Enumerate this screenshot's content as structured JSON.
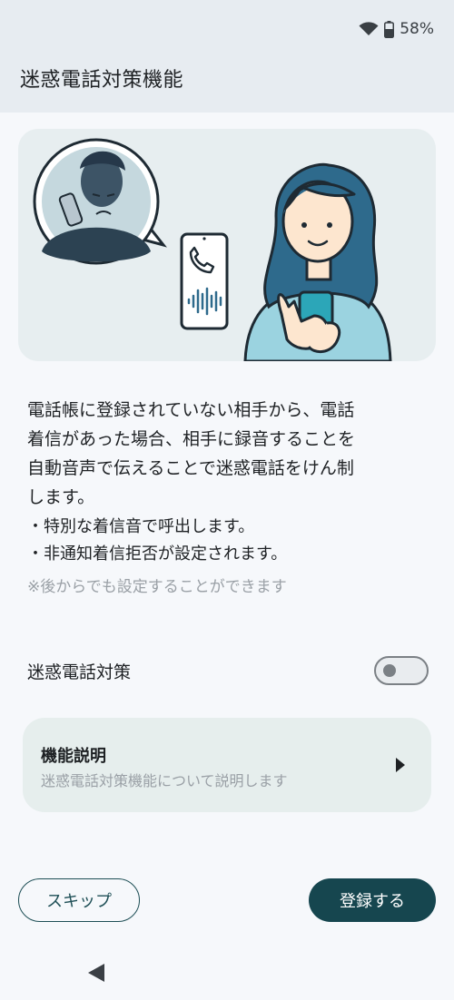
{
  "status_bar": {
    "battery_percent": "58%",
    "icons": [
      "wifi-icon",
      "battery-icon"
    ]
  },
  "header": {
    "title": "迷惑電話対策機能"
  },
  "hero": {
    "illustration": "woman-phone-illustration",
    "colors": {
      "accent": "#1d4e55",
      "skin": "#fde6cf",
      "hair": "#2e6a8c"
    }
  },
  "description": "電話帳に登録されていない相手から、電話\n着信があった場合、相手に録音することを\n自動音声で伝えることで迷惑電話をけん制\nします。",
  "bullets": [
    "・特別な着信音で呼出します。",
    "・非通知着信拒否が設定されます。"
  ],
  "note": "※後からでも設定することができます",
  "toggle": {
    "label": "迷惑電話対策",
    "on": false
  },
  "feature_card": {
    "title": "機能説明",
    "subtitle": "迷惑電話対策機能について説明します"
  },
  "buttons": {
    "skip": "スキップ",
    "register": "登録する"
  },
  "colors": {
    "primary": "#16464f",
    "header_bg": "#e7ecf1",
    "card_bg": "#e6eeed"
  }
}
